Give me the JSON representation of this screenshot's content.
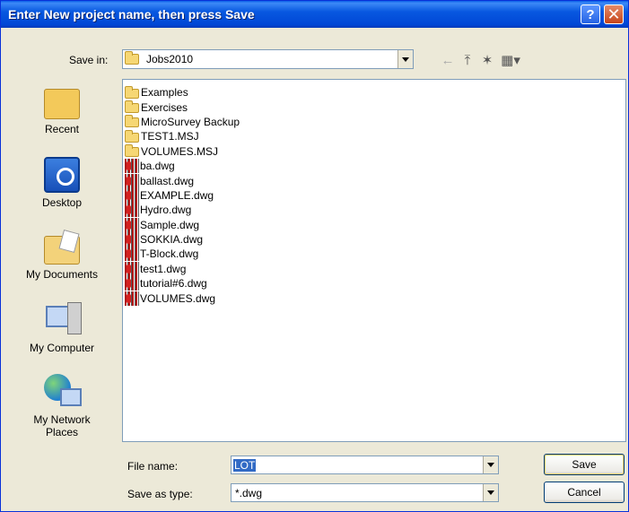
{
  "window": {
    "title": "Enter New project name, then press Save",
    "help_glyph": "?",
    "close_glyph": "✕"
  },
  "save_in": {
    "label": "Save in:",
    "value": "Jobs2010"
  },
  "toolbar": {
    "back_icon": "←",
    "up_icon": "⤒",
    "new_folder_icon": "✶",
    "views_icon": "▦▾"
  },
  "places": [
    {
      "label": "Recent"
    },
    {
      "label": "Desktop"
    },
    {
      "label": "My Documents"
    },
    {
      "label": "My Computer"
    },
    {
      "label": "My Network\nPlaces"
    }
  ],
  "files": [
    {
      "name": "Examples",
      "type": "folder"
    },
    {
      "name": "Exercises",
      "type": "folder"
    },
    {
      "name": "MicroSurvey Backup",
      "type": "folder"
    },
    {
      "name": "TEST1.MSJ",
      "type": "folder"
    },
    {
      "name": "VOLUMES.MSJ",
      "type": "folder"
    },
    {
      "name": "ba.dwg",
      "type": "dwg"
    },
    {
      "name": "ballast.dwg",
      "type": "dwg"
    },
    {
      "name": "EXAMPLE.dwg",
      "type": "dwg"
    },
    {
      "name": "Hydro.dwg",
      "type": "dwg"
    },
    {
      "name": "Sample.dwg",
      "type": "dwg"
    },
    {
      "name": "SOKKIA.dwg",
      "type": "dwg"
    },
    {
      "name": "T-Block.dwg",
      "type": "dwg"
    },
    {
      "name": "test1.dwg",
      "type": "dwg"
    },
    {
      "name": "tutorial#6.dwg",
      "type": "dwg"
    },
    {
      "name": "VOLUMES.dwg",
      "type": "dwg"
    }
  ],
  "file_name": {
    "label": "File name:",
    "value": "LOT"
  },
  "save_as_type": {
    "label": "Save as type:",
    "value": "*.dwg"
  },
  "buttons": {
    "save": "Save",
    "cancel": "Cancel"
  }
}
